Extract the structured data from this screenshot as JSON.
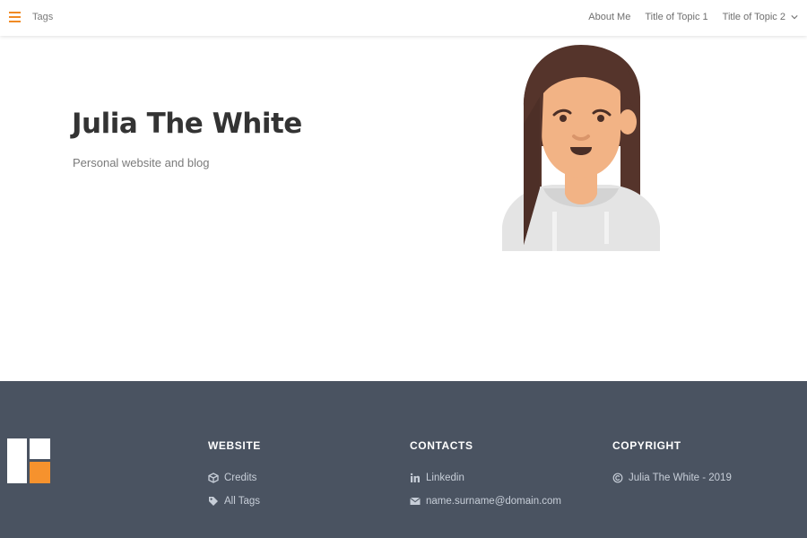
{
  "nav": {
    "left_link": "Tags",
    "right_links": [
      "About Me",
      "Title of Topic 1",
      "Title of Topic 2"
    ]
  },
  "hero": {
    "title": "Julia The White",
    "subtitle": "Personal website and blog"
  },
  "footer": {
    "website": {
      "heading": "WEBSITE",
      "items": [
        {
          "label": "Credits",
          "icon": "cube-icon"
        },
        {
          "label": "All Tags",
          "icon": "tag-icon"
        }
      ]
    },
    "contacts": {
      "heading": "CONTACTS",
      "items": [
        {
          "label": "Linkedin",
          "icon": "linkedin-icon"
        },
        {
          "label": "name.surname@domain.com",
          "icon": "envelope-icon"
        }
      ]
    },
    "copyright": {
      "heading": "COPYRIGHT",
      "items": [
        {
          "label": "Julia The White - 2019",
          "icon": "copyright-icon"
        }
      ]
    }
  },
  "colors": {
    "accent": "#f08a24",
    "footer_bg": "#4a5361",
    "footer_text": "#c7ced8"
  }
}
